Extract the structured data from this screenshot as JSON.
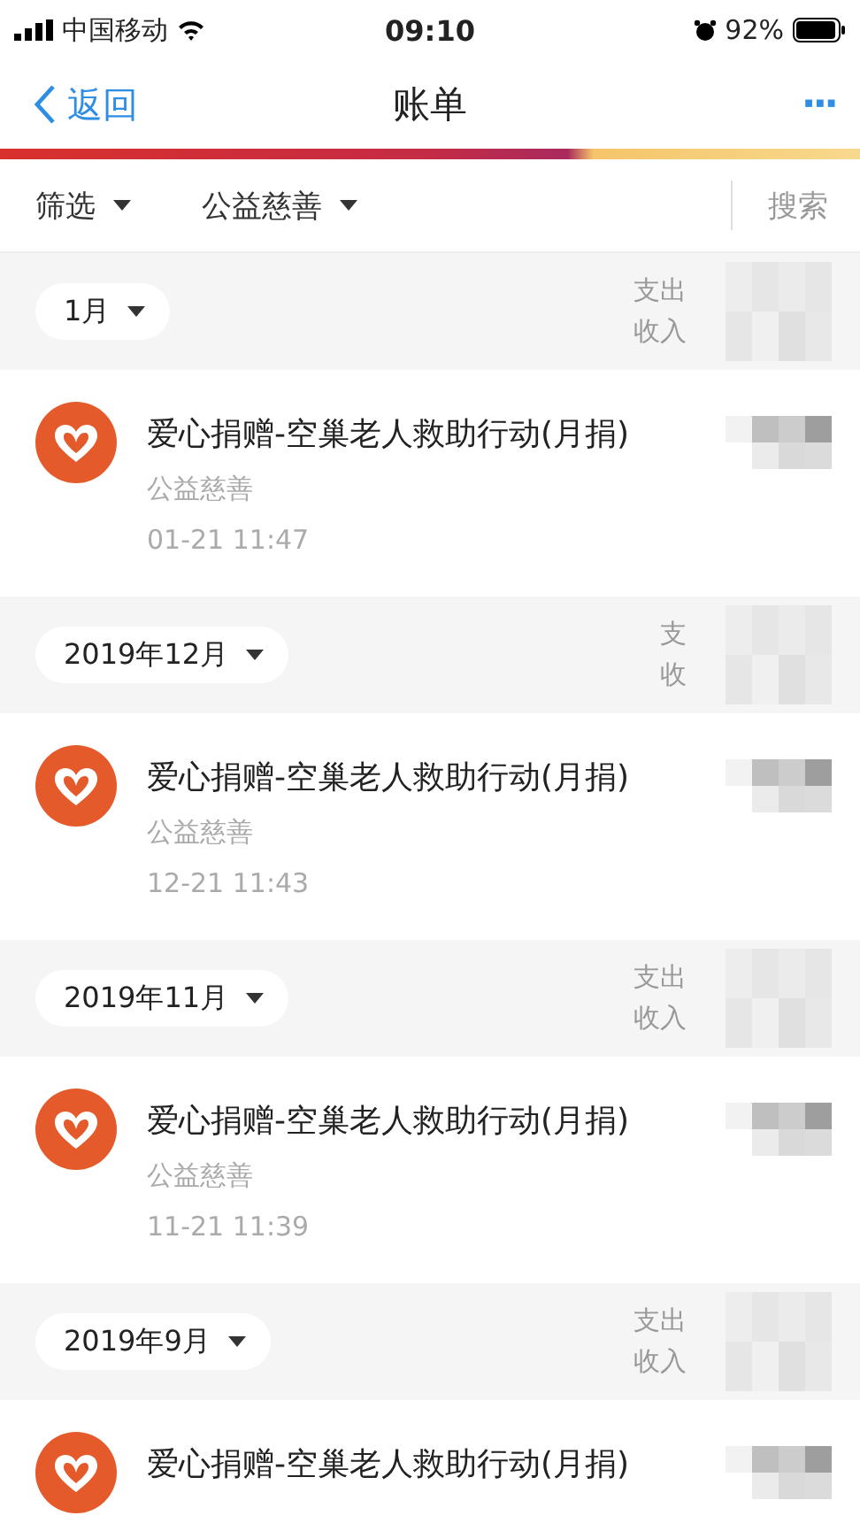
{
  "status_bar": {
    "carrier": "中国移动",
    "time": "09:10",
    "battery": "92%"
  },
  "nav": {
    "back": "返回",
    "title": "账单",
    "more": "···"
  },
  "filters": [
    {
      "label": "筛选"
    },
    {
      "label": "公益慈善"
    }
  ],
  "search": "搜索",
  "sections": [
    {
      "month": "1月",
      "expense_label": "支出",
      "income_label": "收入",
      "items": [
        {
          "title": "爱心捐赠-空巢老人救助行动(月捐)",
          "category": "公益慈善",
          "time": "01-21  11:47"
        }
      ]
    },
    {
      "month": "2019年12月",
      "expense_label": "支",
      "income_label": "收",
      "items": [
        {
          "title": "爱心捐赠-空巢老人救助行动(月捐)",
          "category": "公益慈善",
          "time": "12-21  11:43"
        }
      ]
    },
    {
      "month": "2019年11月",
      "expense_label": "支出",
      "income_label": "收入",
      "items": [
        {
          "title": "爱心捐赠-空巢老人救助行动(月捐)",
          "category": "公益慈善",
          "time": "11-21  11:39"
        }
      ]
    },
    {
      "month": "2019年9月",
      "expense_label": "支出",
      "income_label": "收入",
      "items": [
        {
          "title": "爱心捐赠-空巢老人救助行动(月捐)"
        }
      ]
    }
  ]
}
